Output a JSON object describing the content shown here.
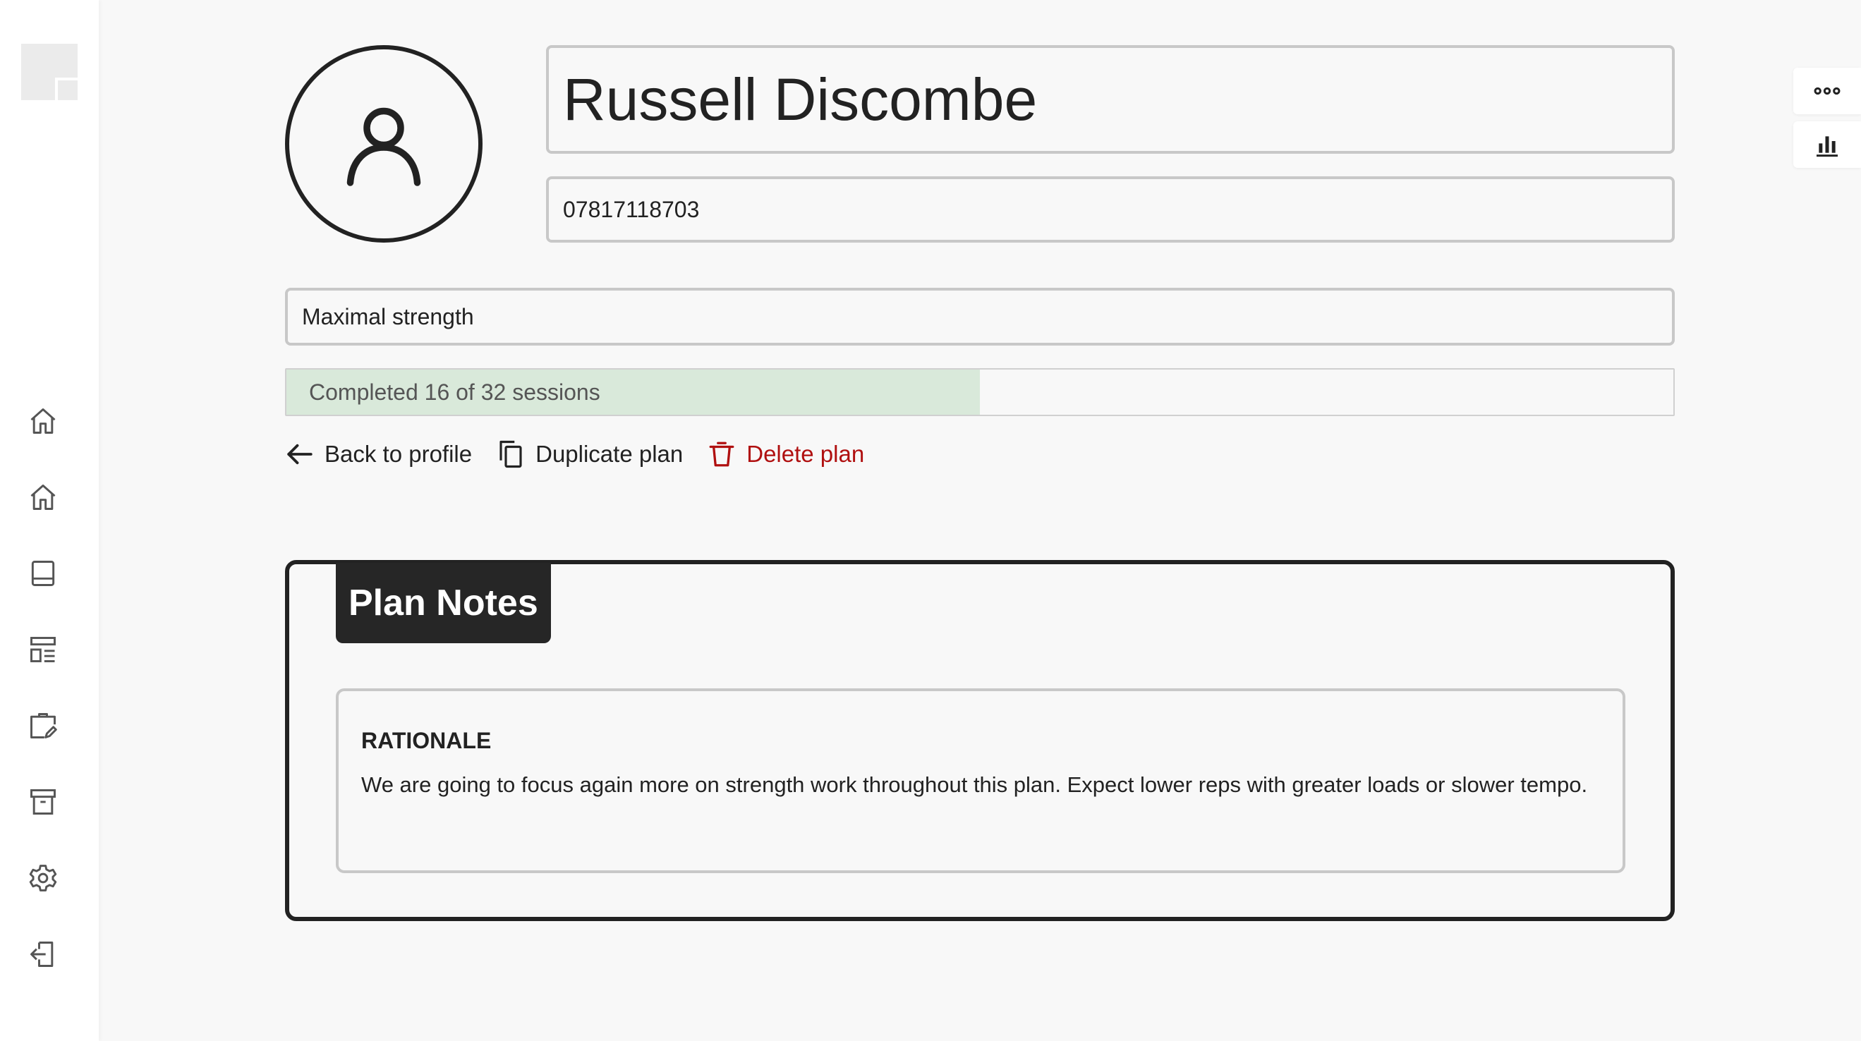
{
  "profile": {
    "name": "Russell Discombe",
    "phone": "07817118703"
  },
  "plan": {
    "goal": "Maximal strength",
    "progress_label": "Completed 16 of 32 sessions",
    "completed_sessions": 16,
    "total_sessions": 32
  },
  "actions": {
    "back_label": "Back to profile",
    "duplicate_label": "Duplicate plan",
    "delete_label": "Delete plan"
  },
  "notes": {
    "title": "Plan Notes",
    "rationale_heading": "RATIONALE",
    "rationale_text": "We are going to focus again more on strength work throughout this plan. Expect lower reps with greater loads or slower tempo."
  },
  "sidebar": {
    "items": [
      {
        "icon": "home-icon"
      },
      {
        "icon": "home-icon"
      },
      {
        "icon": "book-icon"
      },
      {
        "icon": "layout-icon"
      },
      {
        "icon": "clipboard-edit-icon"
      },
      {
        "icon": "archive-icon"
      },
      {
        "icon": "gear-icon"
      },
      {
        "icon": "logout-icon"
      }
    ]
  },
  "floating": {
    "items": [
      {
        "icon": "more-icon"
      },
      {
        "icon": "bar-chart-icon"
      }
    ]
  },
  "colors": {
    "progress_fill": "#d9e9da",
    "danger": "#b01010",
    "notes_header": "#262626"
  }
}
